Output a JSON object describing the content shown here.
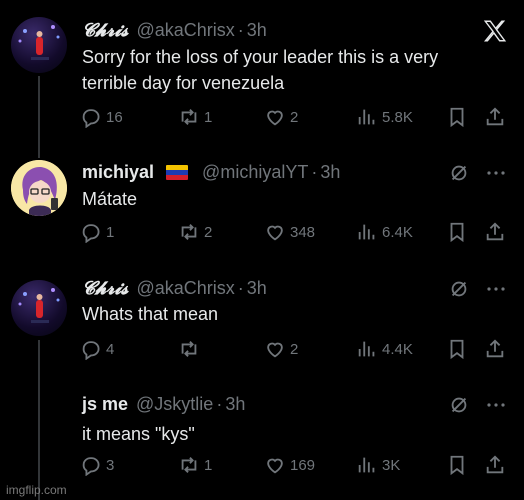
{
  "tweets": [
    {
      "name": "𝓒𝓱𝓻𝓲𝓼",
      "handle": "@akaChrisx",
      "dot": "·",
      "time": "3h",
      "text": "Sorry for the loss of your leader this is a very\nterrible day for venezuela",
      "replies": "16",
      "reposts": "1",
      "likes": "2",
      "views": "5.8K"
    },
    {
      "name": "michiyal",
      "handle": "@michiyalYT",
      "dot": "·",
      "time": "3h",
      "text": "Mátate",
      "replies": "1",
      "reposts": "2",
      "likes": "348",
      "views": "6.4K"
    },
    {
      "name": "𝓒𝓱𝓻𝓲𝓼",
      "handle": "@akaChrisx",
      "dot": "·",
      "time": "3h",
      "text": "Whats that mean",
      "replies": "4",
      "reposts": "",
      "likes": "2",
      "views": "4.4K"
    },
    {
      "name": "js me",
      "handle": "@Jskytlie",
      "dot": "·",
      "time": "3h",
      "text": "it means \"kys\"",
      "replies": "3",
      "reposts": "1",
      "likes": "169",
      "views": "3K"
    }
  ],
  "watermark": "imgflip.com",
  "colors": {
    "background": "#000000",
    "text": "#e7e9ea",
    "muted": "#71767b",
    "thread_line": "#333639"
  },
  "icons": [
    "x-logo-icon",
    "grok-icon",
    "more-icon",
    "reply-icon",
    "repost-icon",
    "like-icon",
    "views-icon",
    "bookmark-icon",
    "share-icon",
    "venezuela-flag-icon"
  ]
}
